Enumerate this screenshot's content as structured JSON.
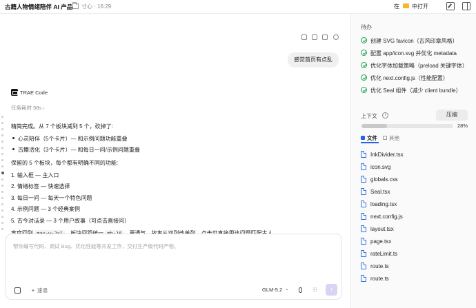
{
  "topbar": {
    "title": "古籍人物情绪陪伴 AI 产品",
    "project": "寸心 · 16:29",
    "open_in": "在",
    "open_label": "中打开"
  },
  "chat": {
    "user_message": "感觉首页有点乱",
    "bot_name": "TRAE Code",
    "elapsed": "任务耗时 58s",
    "elapsed_chevron": "›",
    "lines": {
      "l1": "精简完成。从 7 个板块减到 5 个，砍掉了:",
      "b1": "心灵陪伴（5个卡片）— 和示例问题功能重叠",
      "b2": "古籍活化（3个卡片）— 和每日一问/示例问题重叠",
      "l2": "保留的 5 个板块，每个都有明确不同的功能:",
      "n1": "1. 输入框 — 主入口",
      "n2": "2. 情绪标签 — 快速选择",
      "n3": "3. 每日一问 — 每天一个特色问题",
      "n4": "4. 示例问题 — 3 个经典案例",
      "n5": "5. 古今对话录 — 3 个用户故事（可点击直接问）",
      "last_a": "宽度回到",
      "code1": "max-w-2xl",
      "last_b": "，板块间距统一",
      "code2": "mb-16",
      "last_c": "，更透气。故事从双列改单列，点击可直接用该问题匹配古人。"
    }
  },
  "composer": {
    "placeholder": "帮你编写代码、调试 Bug、优化性能等开发工作，交付生产级代码产物。",
    "boost_label": "速通",
    "model": "GLM-5.2",
    "send_label": "↑",
    "wave_label": "⦙⦙⦙"
  },
  "panel": {
    "todo_title": "待办",
    "todos": [
      "创建 SVG favicon（古风印章风格）",
      "配置 app/icon.svg 并优化 metadata",
      "优化字体加载策略（preload 关键字体）",
      "优化 next.config.js（性能配置）",
      "优化 Seal 组件（减少 client bundle）"
    ],
    "context_title": "上下文",
    "context_info": "i",
    "compress_label": "压缩",
    "progress": 0.28,
    "progress_label": "28%",
    "tab_files": "文件",
    "tab_other": "其他",
    "files": [
      "InkDivider.tsx",
      "icon.svg",
      "globals.css",
      "Seal.tsx",
      "loading.tsx",
      "next.config.js",
      "layout.tsx",
      "page.tsx",
      "rateLimit.ts",
      "route.ts",
      "route.ts"
    ]
  },
  "colors": {
    "accent": "#2563eb",
    "todo_done": "#16a34a",
    "send_bg": "#d7d4f4",
    "folder": "#f4b829"
  }
}
